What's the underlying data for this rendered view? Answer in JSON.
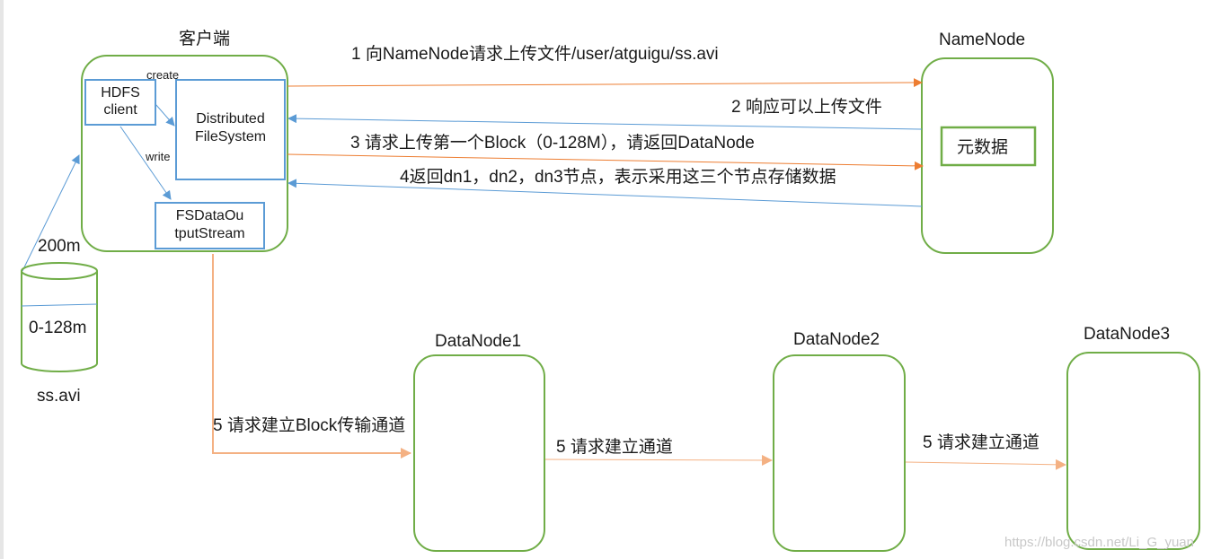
{
  "client": {
    "title": "客户端",
    "hdfs_client": [
      "HDFS",
      "client"
    ],
    "distributed_fs": [
      "Distributed",
      "FileSystem"
    ],
    "fs_output": [
      "FSDataOu",
      "tputStream"
    ],
    "create_label": "create",
    "write_label": "write"
  },
  "file": {
    "size_label": "200m",
    "block_label": "0-128m",
    "name": "ss.avi"
  },
  "namenode": {
    "title": "NameNode",
    "metadata": "元数据"
  },
  "steps": {
    "s1": "1 向NameNode请求上传文件/user/atguigu/ss.avi",
    "s2": "2 响应可以上传文件",
    "s3": "3 请求上传第一个Block（0-128M），请返回DataNode",
    "s4": "4返回dn1，dn2，dn3节点，表示采用这三个节点存储数据",
    "s5a": "5 请求建立Block传输通道",
    "s5b": "5 请求建立通道",
    "s5c": "5 请求建立通道"
  },
  "datanodes": [
    {
      "title": "DataNode1"
    },
    {
      "title": "DataNode2"
    },
    {
      "title": "DataNode3"
    }
  ],
  "watermark": "https://blog.csdn.net/Li_G_yuan",
  "colors": {
    "green": "#70ad47",
    "blue": "#5b9bd5",
    "orange": "#ed7d31",
    "light_orange": "#f4b183"
  }
}
